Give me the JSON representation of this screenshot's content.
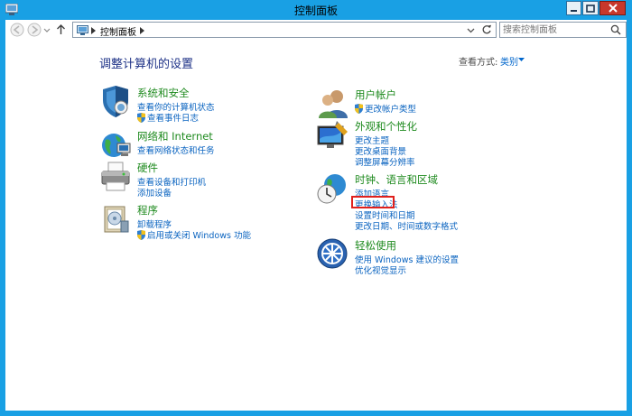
{
  "window": {
    "title": "控制面板"
  },
  "address": {
    "path": "控制面板"
  },
  "search": {
    "placeholder": "搜索控制面板"
  },
  "content": {
    "heading": "调整计算机的设置",
    "view_by_label": "查看方式:",
    "view_by_value": "类别"
  },
  "categories": {
    "system": {
      "title": "系统和安全",
      "links": [
        "查看你的计算机状态",
        "查看事件日志"
      ]
    },
    "network": {
      "title": "网络和 Internet",
      "links": [
        "查看网络状态和任务"
      ]
    },
    "hardware": {
      "title": "硬件",
      "links": [
        "查看设备和打印机",
        "添加设备"
      ]
    },
    "programs": {
      "title": "程序",
      "links": [
        "卸载程序",
        "启用或关闭 Windows 功能"
      ]
    },
    "user": {
      "title": "用户帐户",
      "links": [
        "更改帐户类型"
      ]
    },
    "appearance": {
      "title": "外观和个性化",
      "links": [
        "更改主题",
        "更改桌面背景",
        "调整屏幕分辨率"
      ]
    },
    "clock": {
      "title": "时钟、语言和区域",
      "links": [
        "添加语言",
        "更换输入法",
        "设置时间和日期",
        "更改日期、时间或数字格式"
      ]
    },
    "ease": {
      "title": "轻松使用",
      "links": [
        "使用 Windows 建议的设置",
        "优化视觉显示"
      ]
    }
  },
  "colors": {
    "accent_window": "#19a0e4",
    "link": "#0b64c0",
    "category_title": "#1e8a1e",
    "highlight": "#e0201c"
  }
}
